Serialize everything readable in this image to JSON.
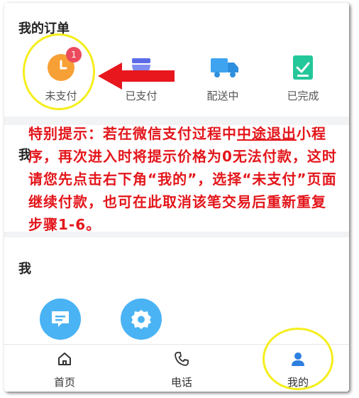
{
  "orders": {
    "title": "我的订单",
    "items": [
      {
        "label": "未支付",
        "icon": "clock-icon",
        "badge": "1",
        "color": "#f7a035"
      },
      {
        "label": "已支付",
        "icon": "bowl-icon",
        "color": "#5b6be8"
      },
      {
        "label": "配送中",
        "icon": "truck-icon",
        "color": "#3fa4f0"
      },
      {
        "label": "已完成",
        "icon": "checklist-icon",
        "color": "#24c79a"
      }
    ]
  },
  "section2": {
    "title": "我"
  },
  "section3": {
    "title": "我"
  },
  "notice": {
    "part1": "特别提示：若在微信支付过程中",
    "part2": "中途退出",
    "part3": "小程序，再次进入时将提示价格为0无法付款，这时请您先点击右下角“我的”，选择“未支付”页面继续付款，也可在此取消该笔交易后重新重复步骤1-6。",
    "color": "#e3161b"
  },
  "services": [
    {
      "icon": "message-icon"
    },
    {
      "icon": "settings-icon"
    }
  ],
  "tabbar": {
    "items": [
      {
        "label": "首页",
        "icon": "home-icon"
      },
      {
        "label": "电话",
        "icon": "phone-icon"
      },
      {
        "label": "我的",
        "icon": "user-icon",
        "active": true
      }
    ],
    "active_color": "#2d7fe0"
  },
  "annotation": {
    "highlight_color": "#f5ee1c",
    "arrow_color": "#e8161d"
  }
}
